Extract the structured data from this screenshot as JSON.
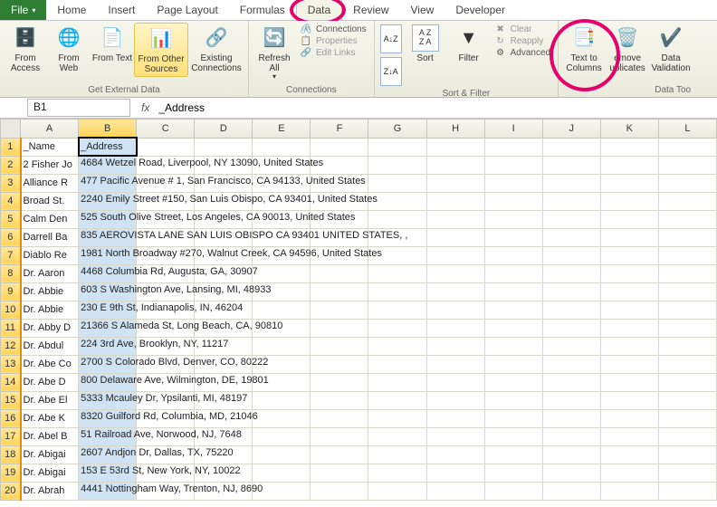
{
  "tabs": {
    "file": "File",
    "items": [
      "Home",
      "Insert",
      "Page Layout",
      "Formulas",
      "Data",
      "Review",
      "View",
      "Developer"
    ],
    "active": "Data"
  },
  "ribbon": {
    "getData": {
      "label": "Get External Data",
      "fromAccess": "From Access",
      "fromWeb": "From Web",
      "fromText": "From Text",
      "fromOther": "From Other Sources",
      "existing": "Existing Connections"
    },
    "connections": {
      "label": "Connections",
      "refreshAll": "Refresh All",
      "connections": "Connections",
      "properties": "Properties",
      "editLinks": "Edit Links"
    },
    "sortFilter": {
      "label": "Sort & Filter",
      "sort": "Sort",
      "filter": "Filter",
      "clear": "Clear",
      "reapply": "Reapply",
      "advanced": "Advanced"
    },
    "dataTools": {
      "label": "Data Too",
      "textToCols": "Text to Columns",
      "removeDup": "emove uplicates",
      "validation": "Data Validation"
    }
  },
  "formulaBar": {
    "nameBox": "B1",
    "formula": "_Address"
  },
  "columns": [
    "A",
    "B",
    "C",
    "D",
    "E",
    "F",
    "G",
    "H",
    "I",
    "J",
    "K",
    "L"
  ],
  "selectedColumn": "B",
  "headerRow": {
    "A": "_Name",
    "B": "_Address"
  },
  "rows": [
    {
      "n": 2,
      "A": "2 Fisher Jo",
      "B": "4684 Wetzel Road, Liverpool, NY 13090, United States"
    },
    {
      "n": 3,
      "A": "Alliance R",
      "B": "477 Pacific Avenue # 1, San Francisco, CA 94133, United States"
    },
    {
      "n": 4,
      "A": "Broad St. ",
      "B": "2240 Emily Street #150, San Luis Obispo, CA 93401, United States"
    },
    {
      "n": 5,
      "A": "Calm Den",
      "B": "525 South Olive Street, Los Angeles, CA 90013, United States"
    },
    {
      "n": 6,
      "A": "Darrell Ba",
      "B": "835 AEROVISTA LANE  SAN LUIS OBISPO  CA 93401  UNITED STATES, ,"
    },
    {
      "n": 7,
      "A": "Diablo Re",
      "B": "1981 North Broadway #270, Walnut Creek, CA 94596, United States"
    },
    {
      "n": 8,
      "A": "Dr. Aaron",
      "B": "4468 Columbia Rd, Augusta, GA, 30907"
    },
    {
      "n": 9,
      "A": "Dr. Abbie",
      "B": "603 S Washington Ave, Lansing, MI, 48933"
    },
    {
      "n": 10,
      "A": "Dr. Abbie",
      "B": "230 E 9th St, Indianapolis, IN, 46204"
    },
    {
      "n": 11,
      "A": "Dr. Abby D",
      "B": "21366 S Alameda St, Long Beach, CA, 90810"
    },
    {
      "n": 12,
      "A": "Dr. Abdul",
      "B": "224 3rd Ave, Brooklyn, NY, 11217"
    },
    {
      "n": 13,
      "A": "Dr. Abe Co",
      "B": "2700 S Colorado Blvd, Denver, CO, 80222"
    },
    {
      "n": 14,
      "A": "Dr. Abe D",
      "B": "800 Delaware Ave, Wilmington, DE, 19801"
    },
    {
      "n": 15,
      "A": "Dr. Abe El",
      "B": "5333 Mcauley Dr, Ypsilanti, MI, 48197"
    },
    {
      "n": 16,
      "A": "Dr. Abe K",
      "B": "8320 Guilford Rd, Columbia, MD, 21046"
    },
    {
      "n": 17,
      "A": "Dr. Abel B",
      "B": "51 Railroad Ave, Norwood, NJ, 7648"
    },
    {
      "n": 18,
      "A": "Dr. Abigai",
      "B": "2607 Andjon Dr, Dallas, TX, 75220"
    },
    {
      "n": 19,
      "A": "Dr. Abigai",
      "B": "153 E 53rd St, New York, NY, 10022"
    },
    {
      "n": 20,
      "A": "Dr. Abrah",
      "B": "4441 Nottingham Way, Trenton, NJ, 8690"
    }
  ],
  "annotations": {
    "dataTab": "circled",
    "textToColumns": "circled"
  }
}
